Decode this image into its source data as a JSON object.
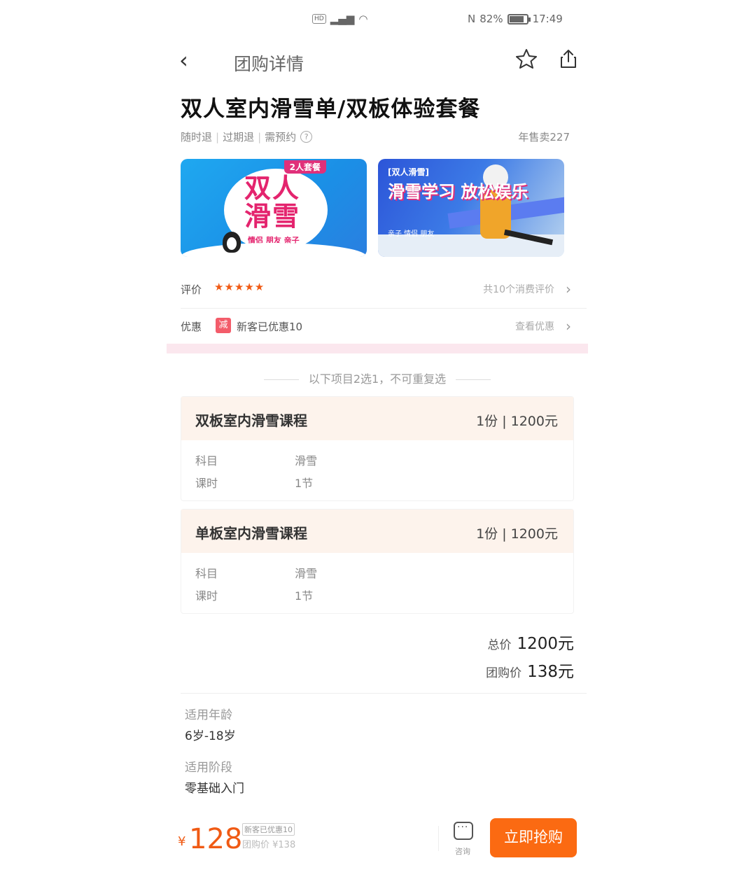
{
  "status_bar": {
    "signal_chip": "HD",
    "battery_percent": "82%",
    "time": "17:49",
    "nfc": "N"
  },
  "nav": {
    "title": "团购详情",
    "back_icon": "‹"
  },
  "product": {
    "title": "双人室内滑雪单/双板体验套餐",
    "tags": [
      "随时退",
      "过期退",
      "需预约"
    ],
    "annual_sales": "年售卖227"
  },
  "banners": [
    {
      "badge": "2人套餐",
      "title": "双人滑雪",
      "subtitle": "情侣 朋友 亲子"
    },
    {
      "tag": "[双人滑雪]",
      "title": "滑雪学习 放松娱乐",
      "subtitle": "亲子 情侣 朋友"
    }
  ],
  "rating": {
    "label": "评价",
    "stars": "★★★★★",
    "stars_value": 5,
    "review_link": "共10个消费评价"
  },
  "discount": {
    "label": "优惠",
    "badge": "减",
    "text": "新客已优惠10",
    "link": "查看优惠"
  },
  "notice": "以下项目2选1，不可重复选",
  "packages": [
    {
      "name": "双板室内滑雪课程",
      "price": "1份 | 1200元",
      "rows": [
        {
          "key": "科目",
          "value": "滑雪"
        },
        {
          "key": "课时",
          "value": "1节"
        }
      ]
    },
    {
      "name": "单板室内滑雪课程",
      "price": "1份 | 1200元",
      "rows": [
        {
          "key": "科目",
          "value": "滑雪"
        },
        {
          "key": "课时",
          "value": "1节"
        }
      ]
    }
  ],
  "totals": {
    "total_label": "总价",
    "total_value": "1200元",
    "group_label": "团购价",
    "group_value": "138元"
  },
  "info": [
    {
      "key": "适用年龄",
      "value": "6岁-18岁"
    },
    {
      "key": "适用阶段",
      "value": "零基础入门"
    }
  ],
  "bottom_bar": {
    "currency": "¥",
    "price": "128",
    "discount_tag": "新客已优惠10",
    "original": "团购价 ¥138",
    "consult_label": "咨询",
    "buy_label": "立即抢购"
  },
  "colors": {
    "accent": "#f05a14",
    "buy_button": "#fb6a12",
    "package_header": "#fdf3ec",
    "section_divider": "#fbe7ee"
  }
}
